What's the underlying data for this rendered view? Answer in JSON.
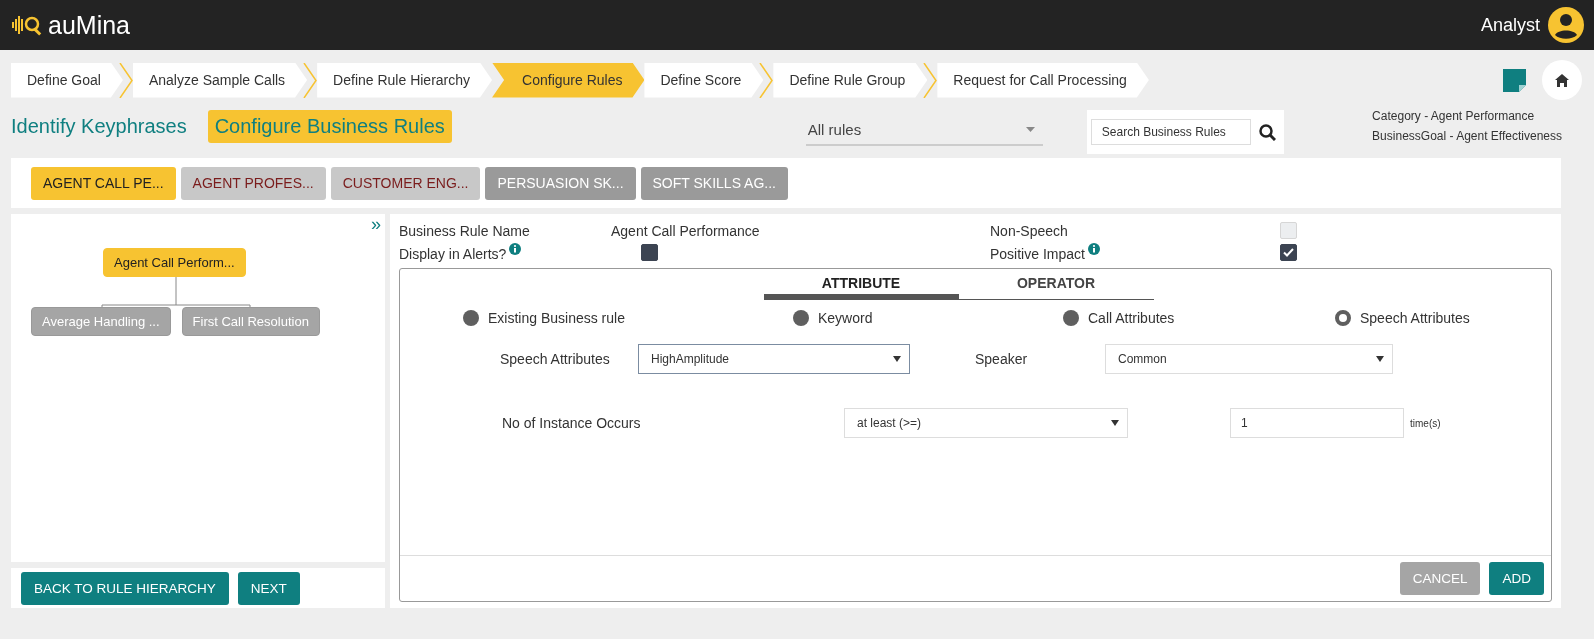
{
  "header": {
    "logo": "auMina",
    "user": "Analyst"
  },
  "steps": [
    {
      "label": "Define Goal",
      "selected": false
    },
    {
      "label": "Analyze Sample Calls",
      "selected": false
    },
    {
      "label": "Define Rule Hierarchy",
      "selected": false
    },
    {
      "label": "Configure Rules",
      "selected": true
    },
    {
      "label": "Define Score",
      "selected": false
    },
    {
      "label": "Define Rule Group",
      "selected": false
    },
    {
      "label": "Request for Call Processing",
      "selected": false
    }
  ],
  "page_tabs": [
    {
      "label": "Identify Keyphrases",
      "selected": false
    },
    {
      "label": "Configure Business Rules",
      "selected": true
    }
  ],
  "filter": {
    "value": "All rules"
  },
  "search": {
    "placeholder": "Search Business Rules"
  },
  "info": [
    "Category - Agent Performance",
    "BusinessGoal - Agent Effectiveness"
  ],
  "rule_groups": [
    {
      "label": "AGENT CALL PE...",
      "kind": "active"
    },
    {
      "label": "AGENT PROFES...",
      "kind": "light"
    },
    {
      "label": "CUSTOMER ENG...",
      "kind": "light"
    },
    {
      "label": "PERSUASION SK...",
      "kind": "dark"
    },
    {
      "label": "SOFT SKILLS AG...",
      "kind": "dark"
    }
  ],
  "tree": {
    "expand": "»",
    "root": {
      "label": "Agent Call Perform...",
      "selected": true,
      "children": [
        {
          "label": "Average Handling ...",
          "selected": false
        },
        {
          "label": "First Call Resolution",
          "selected": false
        }
      ]
    }
  },
  "left_buttons": [
    "BACK TO RULE HIERARCHY",
    "NEXT"
  ],
  "rule": {
    "name_label": "Business Rule Name",
    "name": "Agent Call Performance",
    "non_speech_label": "Non-Speech",
    "non_speech": false,
    "alerts_label": "Display in Alerts?",
    "alerts": true,
    "positive_label": "Positive Impact",
    "positive": true
  },
  "editor_tabs": [
    {
      "label": "ATTRIBUTE",
      "selected": true
    },
    {
      "label": "OPERATOR",
      "selected": false
    }
  ],
  "radios": [
    {
      "label": "Existing Business rule",
      "selected": false
    },
    {
      "label": "Keyword",
      "selected": false
    },
    {
      "label": "Call Attributes",
      "selected": false
    },
    {
      "label": "Speech Attributes",
      "selected": true
    }
  ],
  "speech_attr": {
    "label": "Speech Attributes",
    "value": "HighAmplitude"
  },
  "speaker": {
    "label": "Speaker",
    "value": "Common"
  },
  "instances": {
    "label": "No of Instance Occurs",
    "operator": "at least (>=)",
    "count": "1",
    "unit": "time(s)"
  },
  "buttons": [
    {
      "label": "CANCEL",
      "disabled": true
    },
    {
      "label": "ADD",
      "disabled": false
    }
  ]
}
